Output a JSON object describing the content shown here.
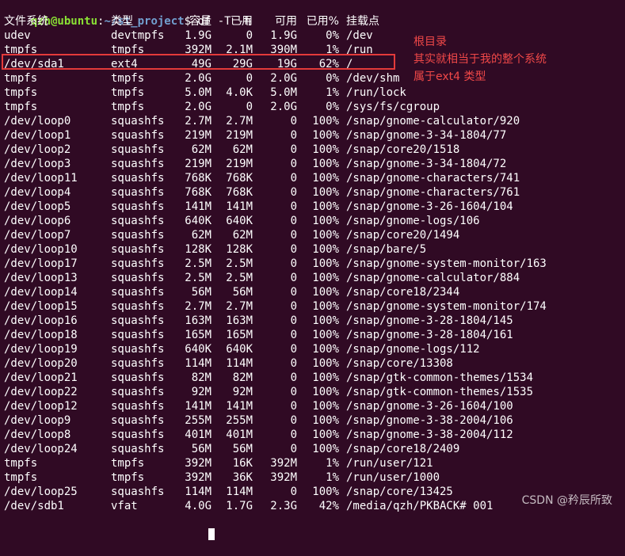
{
  "prompt": {
    "user_host": "qzh@ubuntu",
    "path": "~/st_project",
    "symbol": "$ ",
    "command": "df -T -h"
  },
  "header": {
    "filesystem": "文件系统",
    "type": "类型",
    "size": "容量",
    "used": "已用",
    "avail": "可用",
    "use_pct": "已用%",
    "mount": "挂载点"
  },
  "rows": [
    {
      "fs": "udev",
      "type": "devtmpfs",
      "size": "1.9G",
      "used": "0",
      "avail": "1.9G",
      "pct": "0%",
      "mount": "/dev"
    },
    {
      "fs": "tmpfs",
      "type": "tmpfs",
      "size": "392M",
      "used": "2.1M",
      "avail": "390M",
      "pct": "1%",
      "mount": "/run"
    },
    {
      "fs": "/dev/sda1",
      "type": "ext4",
      "size": "49G",
      "used": "29G",
      "avail": "19G",
      "pct": "62%",
      "mount": "/"
    },
    {
      "fs": "tmpfs",
      "type": "tmpfs",
      "size": "2.0G",
      "used": "0",
      "avail": "2.0G",
      "pct": "0%",
      "mount": "/dev/shm"
    },
    {
      "fs": "tmpfs",
      "type": "tmpfs",
      "size": "5.0M",
      "used": "4.0K",
      "avail": "5.0M",
      "pct": "1%",
      "mount": "/run/lock"
    },
    {
      "fs": "tmpfs",
      "type": "tmpfs",
      "size": "2.0G",
      "used": "0",
      "avail": "2.0G",
      "pct": "0%",
      "mount": "/sys/fs/cgroup"
    },
    {
      "fs": "/dev/loop0",
      "type": "squashfs",
      "size": "2.7M",
      "used": "2.7M",
      "avail": "0",
      "pct": "100%",
      "mount": "/snap/gnome-calculator/920"
    },
    {
      "fs": "/dev/loop1",
      "type": "squashfs",
      "size": "219M",
      "used": "219M",
      "avail": "0",
      "pct": "100%",
      "mount": "/snap/gnome-3-34-1804/77"
    },
    {
      "fs": "/dev/loop2",
      "type": "squashfs",
      "size": "62M",
      "used": "62M",
      "avail": "0",
      "pct": "100%",
      "mount": "/snap/core20/1518"
    },
    {
      "fs": "/dev/loop3",
      "type": "squashfs",
      "size": "219M",
      "used": "219M",
      "avail": "0",
      "pct": "100%",
      "mount": "/snap/gnome-3-34-1804/72"
    },
    {
      "fs": "/dev/loop11",
      "type": "squashfs",
      "size": "768K",
      "used": "768K",
      "avail": "0",
      "pct": "100%",
      "mount": "/snap/gnome-characters/741"
    },
    {
      "fs": "/dev/loop4",
      "type": "squashfs",
      "size": "768K",
      "used": "768K",
      "avail": "0",
      "pct": "100%",
      "mount": "/snap/gnome-characters/761"
    },
    {
      "fs": "/dev/loop5",
      "type": "squashfs",
      "size": "141M",
      "used": "141M",
      "avail": "0",
      "pct": "100%",
      "mount": "/snap/gnome-3-26-1604/104"
    },
    {
      "fs": "/dev/loop6",
      "type": "squashfs",
      "size": "640K",
      "used": "640K",
      "avail": "0",
      "pct": "100%",
      "mount": "/snap/gnome-logs/106"
    },
    {
      "fs": "/dev/loop7",
      "type": "squashfs",
      "size": "62M",
      "used": "62M",
      "avail": "0",
      "pct": "100%",
      "mount": "/snap/core20/1494"
    },
    {
      "fs": "/dev/loop10",
      "type": "squashfs",
      "size": "128K",
      "used": "128K",
      "avail": "0",
      "pct": "100%",
      "mount": "/snap/bare/5"
    },
    {
      "fs": "/dev/loop17",
      "type": "squashfs",
      "size": "2.5M",
      "used": "2.5M",
      "avail": "0",
      "pct": "100%",
      "mount": "/snap/gnome-system-monitor/163"
    },
    {
      "fs": "/dev/loop13",
      "type": "squashfs",
      "size": "2.5M",
      "used": "2.5M",
      "avail": "0",
      "pct": "100%",
      "mount": "/snap/gnome-calculator/884"
    },
    {
      "fs": "/dev/loop14",
      "type": "squashfs",
      "size": "56M",
      "used": "56M",
      "avail": "0",
      "pct": "100%",
      "mount": "/snap/core18/2344"
    },
    {
      "fs": "/dev/loop15",
      "type": "squashfs",
      "size": "2.7M",
      "used": "2.7M",
      "avail": "0",
      "pct": "100%",
      "mount": "/snap/gnome-system-monitor/174"
    },
    {
      "fs": "/dev/loop16",
      "type": "squashfs",
      "size": "163M",
      "used": "163M",
      "avail": "0",
      "pct": "100%",
      "mount": "/snap/gnome-3-28-1804/145"
    },
    {
      "fs": "/dev/loop18",
      "type": "squashfs",
      "size": "165M",
      "used": "165M",
      "avail": "0",
      "pct": "100%",
      "mount": "/snap/gnome-3-28-1804/161"
    },
    {
      "fs": "/dev/loop19",
      "type": "squashfs",
      "size": "640K",
      "used": "640K",
      "avail": "0",
      "pct": "100%",
      "mount": "/snap/gnome-logs/112"
    },
    {
      "fs": "/dev/loop20",
      "type": "squashfs",
      "size": "114M",
      "used": "114M",
      "avail": "0",
      "pct": "100%",
      "mount": "/snap/core/13308"
    },
    {
      "fs": "/dev/loop21",
      "type": "squashfs",
      "size": "82M",
      "used": "82M",
      "avail": "0",
      "pct": "100%",
      "mount": "/snap/gtk-common-themes/1534"
    },
    {
      "fs": "/dev/loop22",
      "type": "squashfs",
      "size": "92M",
      "used": "92M",
      "avail": "0",
      "pct": "100%",
      "mount": "/snap/gtk-common-themes/1535"
    },
    {
      "fs": "/dev/loop12",
      "type": "squashfs",
      "size": "141M",
      "used": "141M",
      "avail": "0",
      "pct": "100%",
      "mount": "/snap/gnome-3-26-1604/100"
    },
    {
      "fs": "/dev/loop9",
      "type": "squashfs",
      "size": "255M",
      "used": "255M",
      "avail": "0",
      "pct": "100%",
      "mount": "/snap/gnome-3-38-2004/106"
    },
    {
      "fs": "/dev/loop8",
      "type": "squashfs",
      "size": "401M",
      "used": "401M",
      "avail": "0",
      "pct": "100%",
      "mount": "/snap/gnome-3-38-2004/112"
    },
    {
      "fs": "/dev/loop24",
      "type": "squashfs",
      "size": "56M",
      "used": "56M",
      "avail": "0",
      "pct": "100%",
      "mount": "/snap/core18/2409"
    },
    {
      "fs": "tmpfs",
      "type": "tmpfs",
      "size": "392M",
      "used": "16K",
      "avail": "392M",
      "pct": "1%",
      "mount": "/run/user/121"
    },
    {
      "fs": "tmpfs",
      "type": "tmpfs",
      "size": "392M",
      "used": "36K",
      "avail": "392M",
      "pct": "1%",
      "mount": "/run/user/1000"
    },
    {
      "fs": "/dev/loop25",
      "type": "squashfs",
      "size": "114M",
      "used": "114M",
      "avail": "0",
      "pct": "100%",
      "mount": "/snap/core/13425"
    },
    {
      "fs": "/dev/sdb1",
      "type": "vfat",
      "size": "4.0G",
      "used": "1.7G",
      "avail": "2.3G",
      "pct": "42%",
      "mount": "/media/qzh/PKBACK# 001"
    }
  ],
  "annotation": [
    "根目录",
    "其实就相当于我的整个系统",
    "属于ext4 类型"
  ],
  "watermark": "CSDN @矜辰所致",
  "colors": {
    "background": "#300a24",
    "prompt_user": "#8ae234",
    "prompt_path": "#729fcf",
    "highlight": "#e43a3a",
    "annotation": "#f04848"
  }
}
